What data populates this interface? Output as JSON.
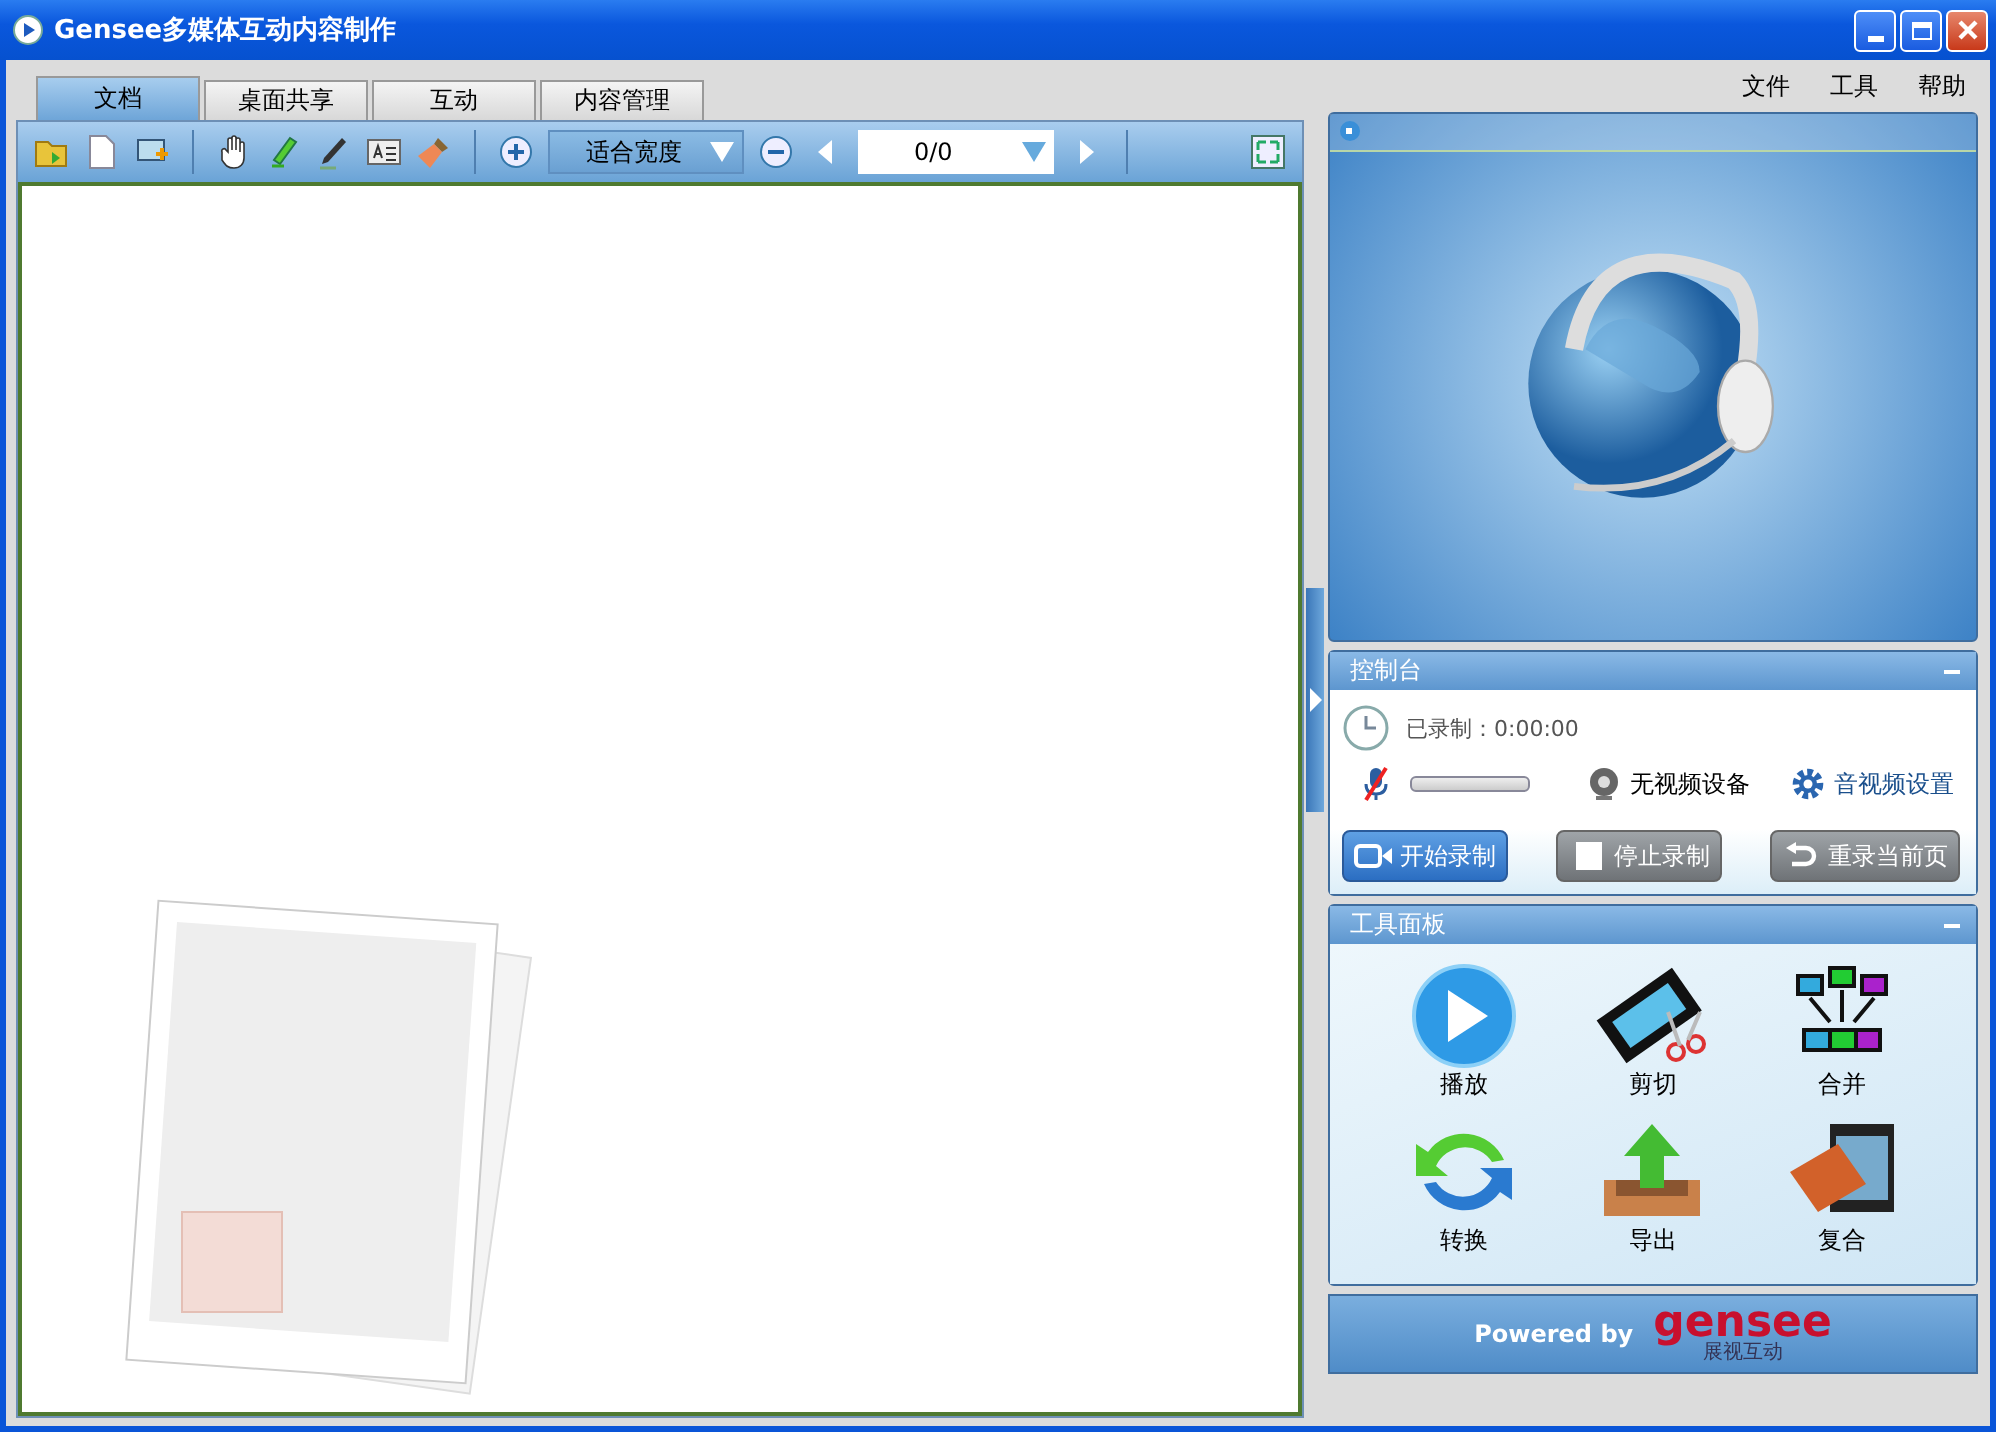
{
  "window": {
    "title": "Gensee多媒体互动内容制作"
  },
  "tabs": [
    {
      "label": "文档",
      "selected": true
    },
    {
      "label": "桌面共享",
      "selected": false
    },
    {
      "label": "互动",
      "selected": false
    },
    {
      "label": "内容管理",
      "selected": false
    }
  ],
  "menu": [
    "文件",
    "工具",
    "帮助"
  ],
  "toolbar": {
    "zoom_select": {
      "value": "适合宽度"
    },
    "page_field": {
      "value": "0/0"
    }
  },
  "console": {
    "title": "控制台",
    "recorded": "已录制：0:00:00",
    "mic": {
      "muted": true
    },
    "camera_status": "无视频设备",
    "settings_link": "音视频设置",
    "buttons": [
      {
        "label": "开始录制",
        "kind": "record",
        "disabled": false
      },
      {
        "label": "停止录制",
        "kind": "stop",
        "disabled": true
      },
      {
        "label": "重录当前页",
        "kind": "redo",
        "disabled": true
      }
    ]
  },
  "tool_panel": {
    "title": "工具面板",
    "tools": [
      {
        "label": "播放",
        "kind": "play"
      },
      {
        "label": "剪切",
        "kind": "cut"
      },
      {
        "label": "合并",
        "kind": "merge"
      },
      {
        "label": "转换",
        "kind": "convert"
      },
      {
        "label": "导出",
        "kind": "export"
      },
      {
        "label": "复合",
        "kind": "composite"
      }
    ]
  },
  "footer": {
    "powered_by": "Powered by",
    "logo": "gensee",
    "logo_subtitle": "展视互动"
  }
}
